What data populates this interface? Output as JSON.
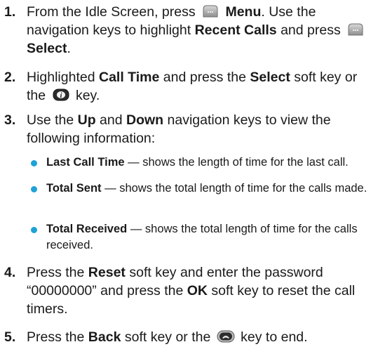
{
  "steps": [
    {
      "num": "1.",
      "parts": [
        "From the Idle Screen, press",
        "Menu",
        ". Use the navigation keys to highlight",
        "Recent Calls",
        "and press",
        "Select",
        "."
      ]
    },
    {
      "num": "2.",
      "parts": [
        "Highlighted",
        "Call Time",
        "and press the",
        "Select",
        "soft key or the",
        "key."
      ]
    },
    {
      "num": "3.",
      "parts": [
        "Use the",
        "Up",
        "and",
        "Down",
        "navigation keys to view the following information:"
      ]
    },
    {
      "num": "4.",
      "parts": [
        "Press the",
        "Reset",
        "soft key and enter the password “00000000” and press the",
        "OK",
        "soft key to reset the call timers."
      ]
    },
    {
      "num": "5.",
      "parts": [
        "Press the",
        "Back",
        "soft key or the",
        "key to end."
      ]
    }
  ],
  "bullets": [
    {
      "term": "Last Call Time",
      "desc": "— shows the length of time for the last call."
    },
    {
      "term": "Total Sent",
      "desc": "— shows the total length of time for the calls made."
    },
    {
      "term": "Total Received",
      "desc": "— shows the total length of time for the calls received."
    }
  ],
  "icons": [
    "softkey-icon",
    "softkey-icon",
    "select-key-icon",
    "end-key-icon"
  ],
  "colors": {
    "bullet": "#1fa1d8",
    "text": "#1a1a1a"
  }
}
